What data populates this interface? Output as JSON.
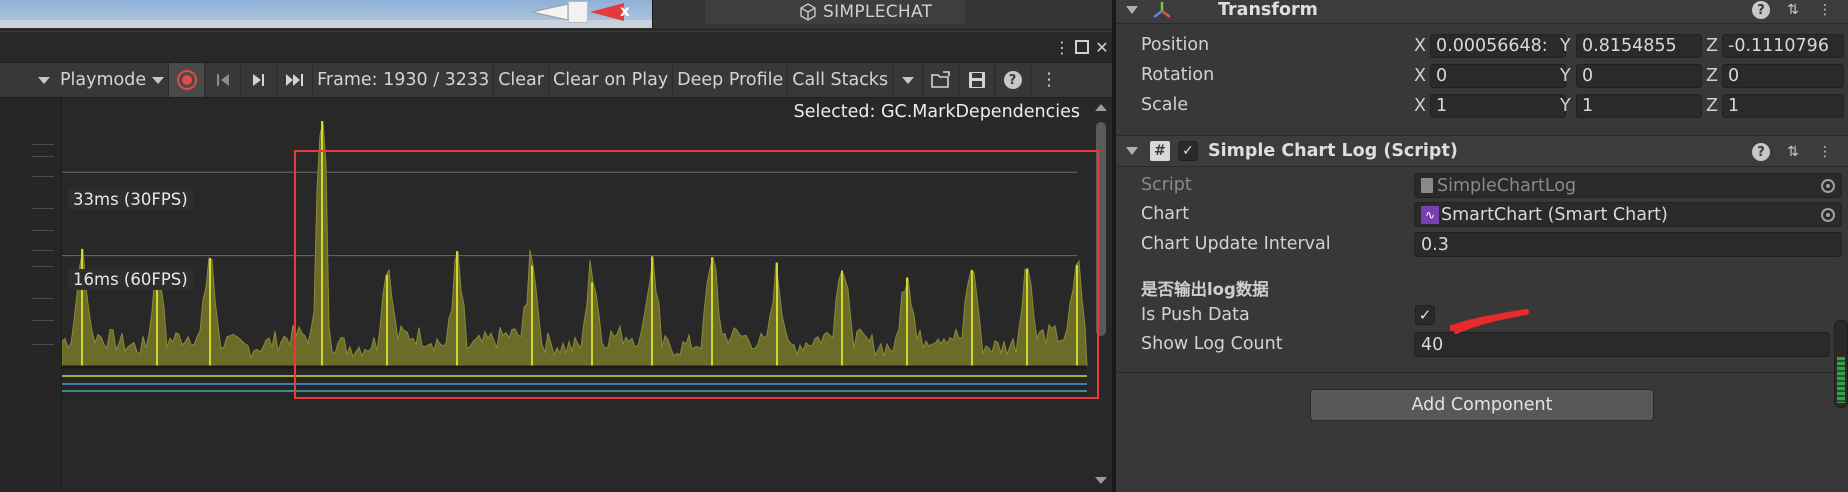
{
  "scene": {
    "tab_label": "SIMPLECHAT",
    "gizmo_axis_label": "x"
  },
  "profiler": {
    "toolbar": {
      "playmode_label": "Playmode",
      "frame_label": "Frame: 1930 / 3233",
      "clear_label": "Clear",
      "clear_on_play_label": "Clear on Play",
      "deep_profile_label": "Deep Profile",
      "call_stacks_label": "Call Stacks"
    },
    "selected_label": "Selected: GC.MarkDependencies",
    "fps_lines": [
      {
        "label": "33ms (30FPS)",
        "ms": 33
      },
      {
        "label": "16ms (60FPS)",
        "ms": 16
      }
    ],
    "colors": {
      "graph_fill": "#6b6b2a",
      "graph_spike": "#d6d62a",
      "highlight_box": "#e83a3a"
    }
  },
  "inspector": {
    "transform": {
      "title": "Transform",
      "position": {
        "label": "Position",
        "x": "0.00056648:",
        "y": "0.8154855",
        "z": "-0.1110796"
      },
      "rotation": {
        "label": "Rotation",
        "x": "0",
        "y": "0",
        "z": "0"
      },
      "scale": {
        "label": "Scale",
        "x": "1",
        "y": "1",
        "z": "1"
      },
      "axes": {
        "x": "X",
        "y": "Y",
        "z": "Z"
      }
    },
    "script_component": {
      "title": "Simple Chart Log (Script)",
      "script": {
        "label": "Script",
        "value": "SimpleChartLog"
      },
      "chart": {
        "label": "Chart",
        "value": "SmartChart (Smart Chart)"
      },
      "chart_update_interval": {
        "label": "Chart Update Interval",
        "value": "0.3"
      },
      "section_title": "是否输出log数据",
      "is_push_data": {
        "label": "Is Push Data",
        "checked": true
      },
      "show_log_count": {
        "label": "Show Log Count",
        "value": "40"
      }
    },
    "add_component_label": "Add Component"
  }
}
